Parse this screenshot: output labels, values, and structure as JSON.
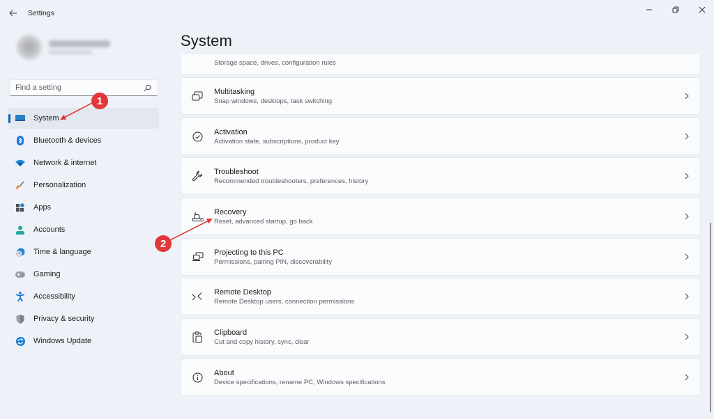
{
  "window": {
    "title": "Settings",
    "back_icon": "arrow-left-icon",
    "controls": {
      "minimize": "minimize-icon",
      "maximize": "restore-icon",
      "close": "close-icon"
    }
  },
  "search": {
    "placeholder": "Find a setting",
    "value": "",
    "icon": "search-icon"
  },
  "sidebar": {
    "items": [
      {
        "label": "System",
        "icon": "system-display-icon",
        "active": true
      },
      {
        "label": "Bluetooth & devices",
        "icon": "bluetooth-icon"
      },
      {
        "label": "Network & internet",
        "icon": "wifi-icon"
      },
      {
        "label": "Personalization",
        "icon": "paintbrush-icon"
      },
      {
        "label": "Apps",
        "icon": "apps-icon"
      },
      {
        "label": "Accounts",
        "icon": "account-icon"
      },
      {
        "label": "Time & language",
        "icon": "globe-clock-icon"
      },
      {
        "label": "Gaming",
        "icon": "gamepad-icon"
      },
      {
        "label": "Accessibility",
        "icon": "accessibility-icon"
      },
      {
        "label": "Privacy & security",
        "icon": "shield-icon"
      },
      {
        "label": "Windows Update",
        "icon": "update-icon"
      }
    ]
  },
  "main": {
    "title": "System",
    "cards": [
      {
        "title": "",
        "desc": "Storage space, drives, configuration rules",
        "icon": "storage-icon"
      },
      {
        "title": "Multitasking",
        "desc": "Snap windows, desktops, task switching",
        "icon": "multitasking-icon"
      },
      {
        "title": "Activation",
        "desc": "Activation state, subscriptions, product key",
        "icon": "checkmark-circle-icon"
      },
      {
        "title": "Troubleshoot",
        "desc": "Recommended troubleshooters, preferences, history",
        "icon": "wrench-icon"
      },
      {
        "title": "Recovery",
        "desc": "Reset, advanced startup, go back",
        "icon": "recovery-icon"
      },
      {
        "title": "Projecting to this PC",
        "desc": "Permissions, pairing PIN, discoverability",
        "icon": "projecting-icon"
      },
      {
        "title": "Remote Desktop",
        "desc": "Remote Desktop users, connection permissions",
        "icon": "remote-desktop-icon"
      },
      {
        "title": "Clipboard",
        "desc": "Cut and copy history, sync, clear",
        "icon": "clipboard-icon"
      },
      {
        "title": "About",
        "desc": "Device specifications, rename PC, Windows specifications",
        "icon": "info-icon"
      }
    ]
  },
  "annotations": [
    {
      "number": "1",
      "target": "System",
      "color": "#e1383a"
    },
    {
      "number": "2",
      "target": "Recovery",
      "color": "#e1383a"
    }
  ],
  "colors": {
    "accent": "#0067c0",
    "background": "#eef2f8",
    "card": "#f9fbfd",
    "annotation": "#e1383a"
  }
}
